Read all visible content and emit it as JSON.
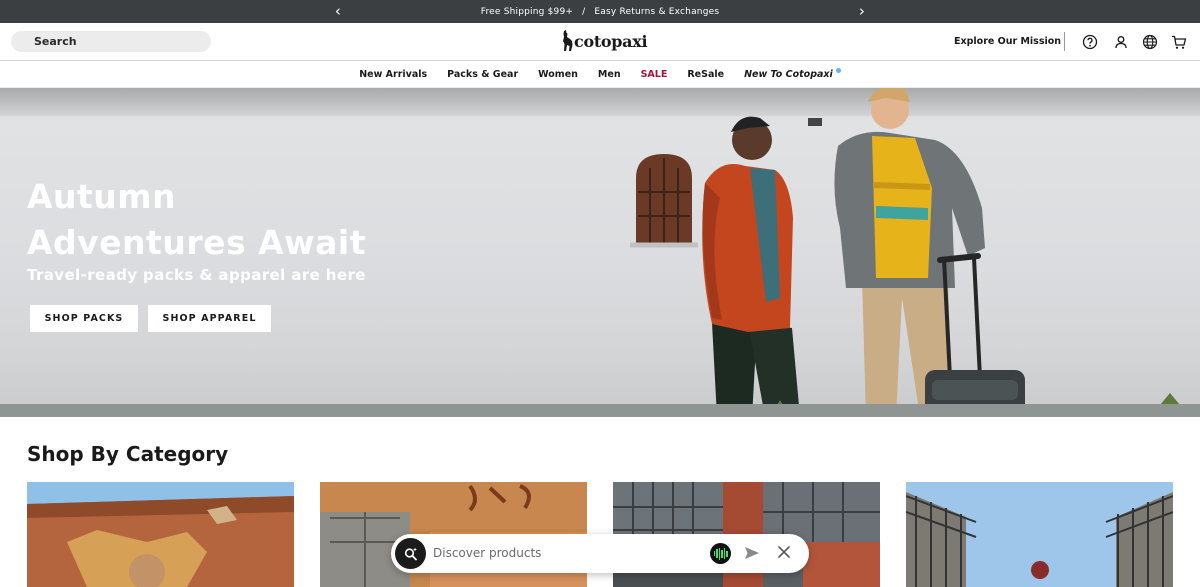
{
  "announcement": {
    "prev_icon": "chevron-left-icon",
    "next_icon": "chevron-right-icon",
    "message_1": "Free Shipping $99+",
    "separator": "/",
    "message_2": "Easy Returns & Exchanges"
  },
  "header": {
    "search_label": "Search",
    "logo_text": "cotopaxi",
    "mission_link": "Explore Our Mission",
    "icons": [
      "help-icon",
      "account-icon",
      "globe-icon",
      "cart-icon"
    ]
  },
  "nav": {
    "items": [
      "New Arrivals",
      "Packs & Gear",
      "Women",
      "Men",
      "SALE",
      "ReSale",
      "New To Cotopaxi"
    ]
  },
  "hero": {
    "title_line_1": "Autumn",
    "title_line_2": "Adventures Await",
    "subtitle": "Travel-ready packs & apparel are here",
    "button_1": "SHOP PACKS",
    "button_2": "SHOP APPAREL"
  },
  "category_section": {
    "title": "Shop By Category"
  },
  "chat": {
    "placeholder": "Discover products",
    "icons": [
      "search-sparkle-icon",
      "voice-wave-icon",
      "send-icon",
      "close-icon"
    ]
  },
  "colors": {
    "announcement_bg": "#3b3f42",
    "sale": "#a0143c",
    "new_dot": "#5fb6ea",
    "jacket_orange": "#c3461f",
    "jacket_yellow": "#e7b31a",
    "jacket_teal": "#3fa3a0"
  }
}
